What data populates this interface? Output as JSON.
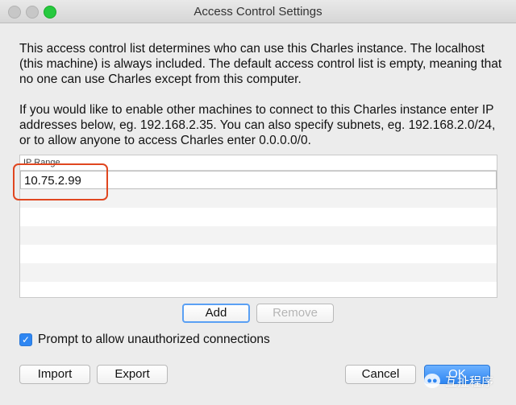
{
  "window": {
    "title": "Access Control Settings"
  },
  "description": {
    "paragraph1": "This access control list determines who can use this Charles instance. The localhost (this machine) is always included. The default access control list is empty, meaning that no one can use Charles except from this computer.",
    "paragraph2": "If you would like to enable other machines to connect to this Charles instance enter IP addresses below, eg. 192.168.2.35. You can also specify subnets, eg. 192.168.2.0/24, or to allow anyone to access Charles enter 0.0.0.0/0."
  },
  "table": {
    "header": "IP Range",
    "rows": [
      "10.75.2.99",
      "",
      "",
      "",
      "",
      "",
      ""
    ]
  },
  "list_buttons": {
    "add": "Add",
    "remove": "Remove"
  },
  "prompt_checkbox": {
    "label": "Prompt to allow unauthorized connections",
    "checked": true
  },
  "footer_buttons": {
    "import": "Import",
    "export": "Export",
    "cancel": "Cancel",
    "ok": "OK"
  },
  "watermark": {
    "text": "互扯程序"
  },
  "colors": {
    "accent": "#2e86f2",
    "highlight": "#e0461f"
  }
}
